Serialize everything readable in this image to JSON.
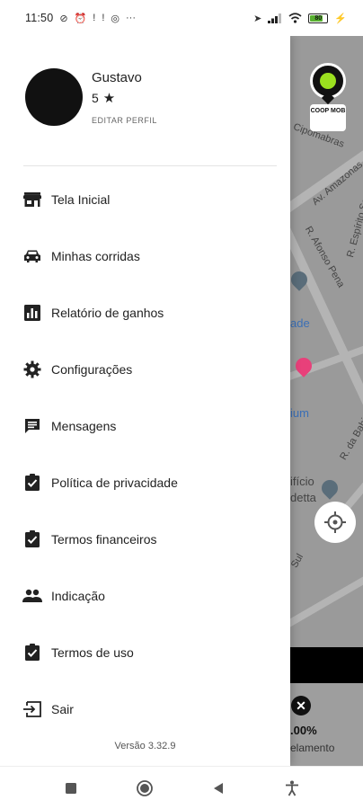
{
  "status_bar": {
    "time": "11:50",
    "battery": "80"
  },
  "profile": {
    "name": "Gustavo",
    "rating": "5",
    "edit_label": "EDITAR PERFIL"
  },
  "menu": {
    "items": [
      {
        "label": "Tela Inicial",
        "icon": "store-icon"
      },
      {
        "label": "Minhas corridas",
        "icon": "car-icon"
      },
      {
        "label": "Relatório de ganhos",
        "icon": "bar-chart-icon"
      },
      {
        "label": "Configurações",
        "icon": "gear-icon"
      },
      {
        "label": "Mensagens",
        "icon": "message-icon"
      },
      {
        "label": "Política de privacidade",
        "icon": "clipboard-check-icon"
      },
      {
        "label": "Termos financeiros",
        "icon": "clipboard-check-icon"
      },
      {
        "label": "Indicação",
        "icon": "people-icon"
      },
      {
        "label": "Termos de uso",
        "icon": "clipboard-check-icon"
      },
      {
        "label": "Sair",
        "icon": "logout-icon"
      }
    ]
  },
  "version": "Versão 3.32.9",
  "map": {
    "street_1": "Av. Amazonas",
    "street_2": "R. Espírito Santo",
    "street_3": "R. Afonso Pena",
    "street_4": "R. da Bahia",
    "label_de": "ade",
    "label_um": "ium",
    "label_ficio": "ifício",
    "label_detta": "detta",
    "label_sul": "Sul",
    "label_cipomabras": "Cipomabras",
    "marker_brand": "COOP MOB",
    "pct": ".00%",
    "cancel_label": "elamento"
  },
  "colors": {
    "accent": "#9be01f",
    "map_bg": "#9a9a9a",
    "pin_pink": "#e8407a",
    "pin_gray": "#5a6d7a"
  }
}
